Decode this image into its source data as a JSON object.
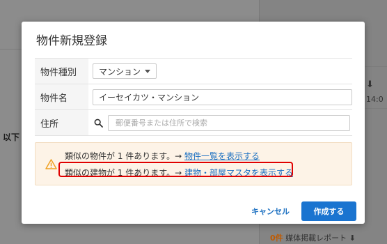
{
  "background": {
    "left_label": "以下",
    "right_time": "14:0",
    "download_glyph": "⬇",
    "bottom_count": "0件",
    "bottom_label": "媒体掲載レポート",
    "bottom_icon": "⬇"
  },
  "modal": {
    "title": "物件新規登録",
    "fields": {
      "type_label": "物件種別",
      "type_value": "マンション",
      "name_label": "物件名",
      "name_value": "イーセイカツ・マンション",
      "address_label": "住所",
      "address_placeholder": "郵便番号または住所で検索"
    },
    "warning": {
      "line1_text": "類似の物件が 1 件あります。→ ",
      "line1_link": "物件一覧を表示する",
      "line2_text": "類似の建物が 1 件あります。→ ",
      "line2_link": "建物・部屋マスタを表示する"
    },
    "buttons": {
      "cancel": "キャンセル",
      "create": "作成する"
    }
  },
  "colors": {
    "accent": "#1a74d0",
    "link": "#1a6fc1",
    "warning_bg": "#fdf3e7",
    "warning_icon": "#f0a020",
    "highlight": "#e00000"
  }
}
